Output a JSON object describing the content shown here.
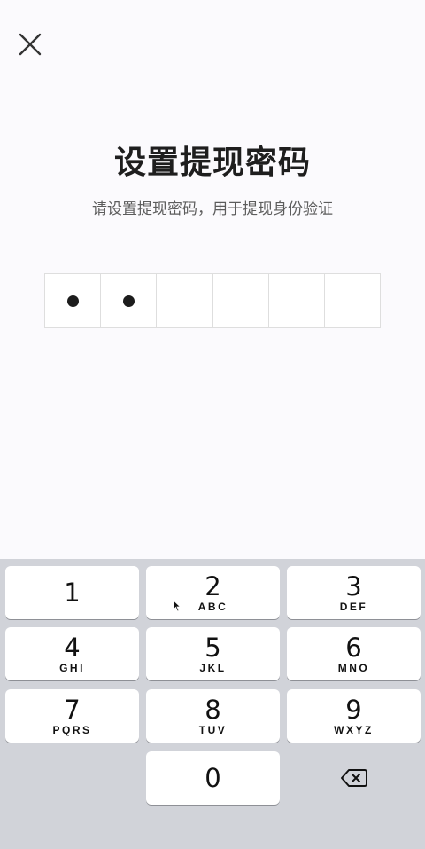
{
  "header": {
    "close_icon": "close-icon"
  },
  "title": "设置提现密码",
  "subtitle": "请设置提现密码，用于提现身份验证",
  "pin": {
    "length": 6,
    "filled": 2
  },
  "keyboard": {
    "keys": [
      {
        "digit": "1",
        "letters": ""
      },
      {
        "digit": "2",
        "letters": "ABC"
      },
      {
        "digit": "3",
        "letters": "DEF"
      },
      {
        "digit": "4",
        "letters": "GHI"
      },
      {
        "digit": "5",
        "letters": "JKL"
      },
      {
        "digit": "6",
        "letters": "MNO"
      },
      {
        "digit": "7",
        "letters": "PQRS"
      },
      {
        "digit": "8",
        "letters": "TUV"
      },
      {
        "digit": "9",
        "letters": "WXYZ"
      },
      {
        "digit": "0",
        "letters": ""
      }
    ],
    "backspace_icon": "backspace-icon"
  }
}
